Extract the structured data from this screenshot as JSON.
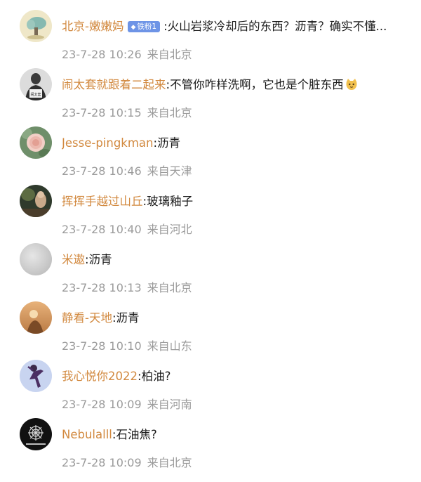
{
  "comments": [
    {
      "username": "北京-嫩嫩妈",
      "badge": "铁粉1",
      "separator": ":",
      "text": "火山岩浆冷却后的东西？沥青？确实不懂...",
      "time": "23-7-28 10:26",
      "location": "来自北京",
      "avatar_icon": "cartoon-avatar-icon"
    },
    {
      "username": "闹太套就跟着二起来",
      "separator": ":",
      "text": "不管你咋样洗啊，它也是个脏东西",
      "emoji": "cat-face-emoji",
      "time": "23-7-28 10:15",
      "location": "来自北京",
      "avatar_icon": "person-avatar-icon",
      "avatar_caption": "闹太套"
    },
    {
      "username": "Jesse-pingkman",
      "separator": ":",
      "text": "沥青",
      "time": "23-7-28 10:46",
      "location": "来自天津",
      "avatar_icon": "rose-avatar-icon"
    },
    {
      "username": "挥挥手越过山丘",
      "separator": ":",
      "text": "玻璃釉子",
      "time": "23-7-28 10:40",
      "location": "来自河北",
      "avatar_icon": "photo-avatar-icon"
    },
    {
      "username": "米遨",
      "separator": ":",
      "text": "沥青",
      "time": "23-7-28 10:13",
      "location": "来自北京",
      "avatar_icon": "blank-avatar-icon"
    },
    {
      "username": "静看-天地",
      "separator": ":",
      "text": "沥青",
      "time": "23-7-28 10:10",
      "location": "来自山东",
      "avatar_icon": "sunset-avatar-icon"
    },
    {
      "username": "我心悦你2022",
      "separator": ":",
      "text": "柏油?",
      "time": "23-7-28 10:09",
      "location": "来自河南",
      "avatar_icon": "dancer-avatar-icon"
    },
    {
      "username": "Nebulalll",
      "separator": ":",
      "text": "石油焦?",
      "time": "23-7-28 10:09",
      "location": "来自北京",
      "avatar_icon": "mandala-avatar-icon"
    }
  ],
  "colors": {
    "username": "#d2893f",
    "text": "#1a1a1a",
    "meta": "#9b9b9b",
    "badge": "#6e94e6"
  }
}
